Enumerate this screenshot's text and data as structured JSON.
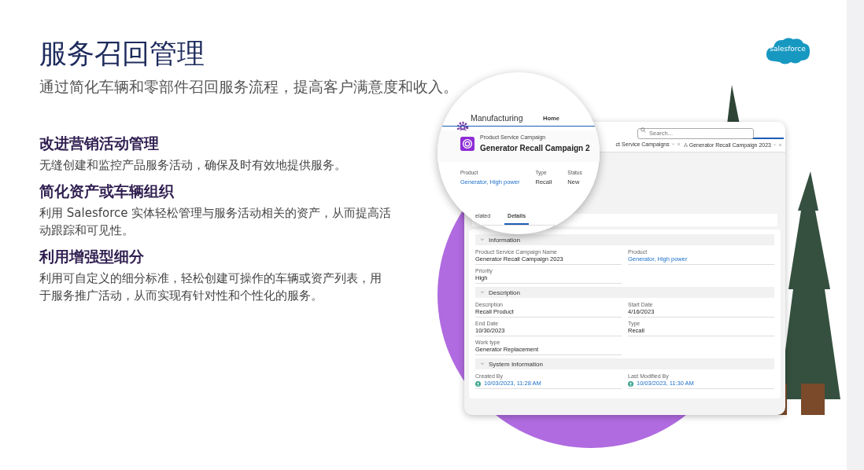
{
  "slide": {
    "title": "服务召回管理",
    "subtitle": "通过简化车辆和零部件召回服务流程，提高客户满意度和收入。",
    "logo_text": "salesforce",
    "features": [
      {
        "heading": "改进营销活动管理",
        "body": "无缝创建和监控产品服务活动，确保及时有效地提供服务。"
      },
      {
        "heading": "简化资产或车辆组织",
        "body": "利用 Salesforce 实体轻松管理与服务活动相关的资产，从而提高活动跟踪和可见性。"
      },
      {
        "heading": "利用增强型细分",
        "body": "利用可自定义的细分标准，轻松创建可操作的车辆或资产列表，用于服务推广活动，从而实现有针对性和个性化的服务。"
      }
    ]
  },
  "app": {
    "app_name": "Manufacturing",
    "nav_items": [
      {
        "label": "Home",
        "selected": true
      }
    ],
    "search_placeholder": "Search...",
    "tabs": [
      {
        "label": "ct Service Campaigns",
        "selected": false
      },
      {
        "label": "Generator Recall Campaign 2023",
        "selected": true
      }
    ],
    "record": {
      "object_type": "Product Service Campaign",
      "name": "Generator Recall Campaign 2",
      "highlights": [
        {
          "label": "Product",
          "value": "Generator, High power",
          "kind": "link"
        },
        {
          "label": "Type",
          "value": "Recall",
          "kind": "text"
        },
        {
          "label": "Status",
          "value": "New",
          "kind": "text"
        }
      ]
    },
    "record_tabs": [
      {
        "label": "elated",
        "selected": false
      },
      {
        "label": "Details",
        "selected": true
      }
    ],
    "sections": [
      {
        "title": "Information",
        "expanded": true,
        "fields": [
          {
            "label": "Product Service Campaign Name",
            "value": "Generator Recall Campaign 2023",
            "kind": "text"
          },
          {
            "label": "Product",
            "value": "Generator, High power",
            "kind": "link"
          },
          {
            "label": "Priority",
            "value": "High",
            "kind": "text"
          }
        ]
      },
      {
        "title": "Description",
        "expanded": true,
        "fields": [
          {
            "label": "Description",
            "value": "Recall Product",
            "kind": "text"
          },
          {
            "label": "Start Date",
            "value": "4/16/2023",
            "kind": "text"
          },
          {
            "label": "End Date",
            "value": "10/30/2023",
            "kind": "text"
          },
          {
            "label": "Type",
            "value": "Recall",
            "kind": "text"
          },
          {
            "label": "Work type",
            "value": "Generator Replacement",
            "kind": "text"
          }
        ]
      },
      {
        "title": "System Information",
        "expanded": true,
        "fields": [
          {
            "label": "Created By",
            "value": "10/03/2023, 11:28 AM",
            "kind": "user"
          },
          {
            "label": "Last Modified By",
            "value": "10/03/2023, 11:30 AM",
            "kind": "user"
          }
        ]
      }
    ]
  }
}
